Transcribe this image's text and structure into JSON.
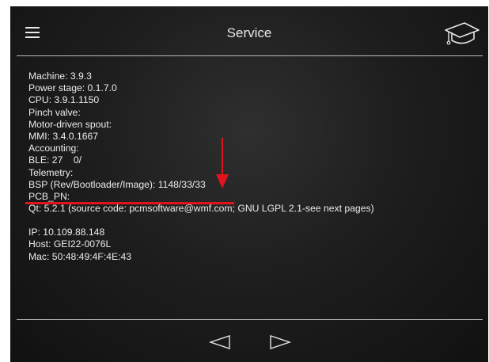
{
  "header": {
    "title": "Service",
    "menu_icon": "hamburger-menu-icon",
    "help_icon": "graduation-cap-icon"
  },
  "info_lines": [
    "Machine: 3.9.3",
    "Power stage: 0.1.7.0",
    "CPU: 3.9.1.1150",
    "Pinch valve:",
    "Motor-driven spout:",
    "MMI: 3.4.0.1667",
    "Accounting:",
    "BLE: 27    0/",
    "Telemetry:",
    "BSP (Rev/Bootloader/Image): 1148/33/33",
    "PCB_PN:",
    "Qt: 5.2.1 (source code: pcmsoftware@wmf.com; GNU LGPL 2.1-see next pages)"
  ],
  "network_lines": [
    "IP: 10.109.88.148",
    "Host: GEI22-0076L",
    "Mac: 50:48:49:4F:4E:43"
  ],
  "footer": {
    "prev_icon": "triangle-left-icon",
    "next_icon": "triangle-right-icon"
  },
  "colors": {
    "background": "#1e1e1e",
    "text": "#ececec",
    "annotation": "#e0141c"
  }
}
